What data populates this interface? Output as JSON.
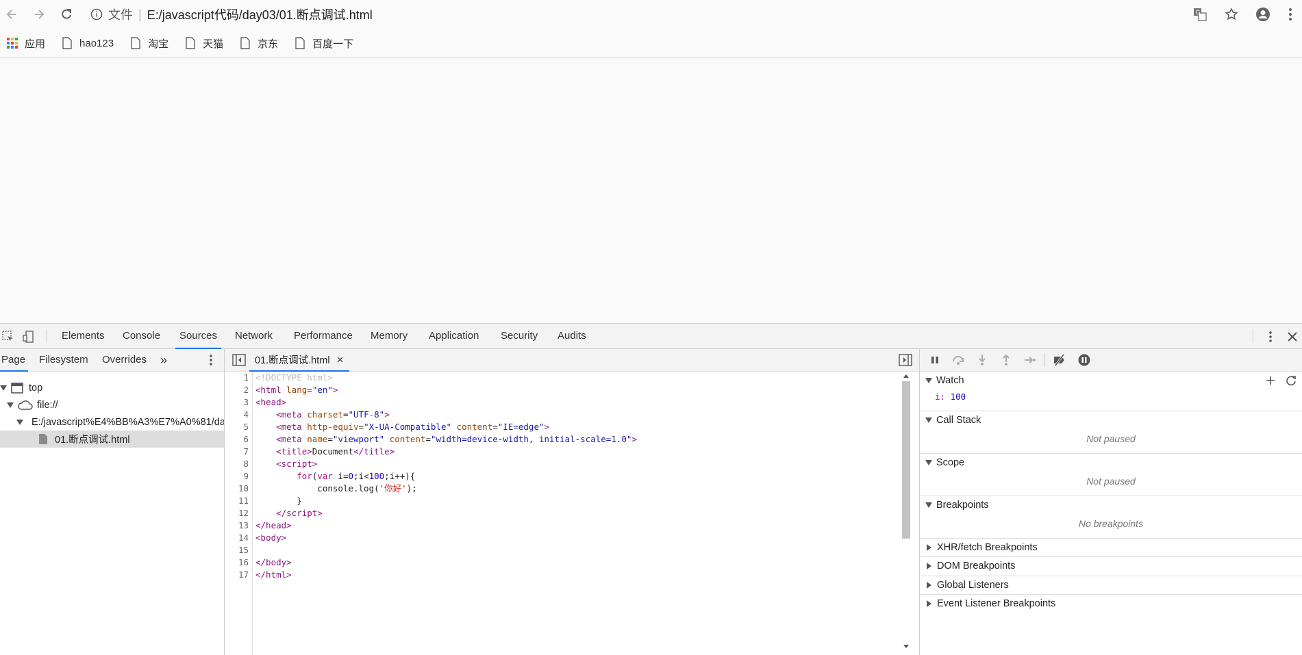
{
  "browser": {
    "scheme_label": "文件",
    "separator": "|",
    "url": "E:/javascript代码/day03/01.断点调试.html",
    "bookmarks": [
      {
        "label": "应用",
        "icon": "apps-grid-icon"
      },
      {
        "label": "hao123",
        "icon": "page-icon"
      },
      {
        "label": "淘宝",
        "icon": "page-icon"
      },
      {
        "label": "天猫",
        "icon": "page-icon"
      },
      {
        "label": "京东",
        "icon": "page-icon"
      },
      {
        "label": "百度一下",
        "icon": "page-icon"
      }
    ]
  },
  "devtools": {
    "tabs": [
      "Elements",
      "Console",
      "Sources",
      "Network",
      "Performance",
      "Memory",
      "Application",
      "Security",
      "Audits"
    ],
    "active_tab": "Sources",
    "navigator": {
      "subtabs": [
        "Page",
        "Filesystem",
        "Overrides"
      ],
      "more": "»",
      "tree": {
        "top": "top",
        "origin": "file://",
        "folder": "E:/javascript%E4%BB%A3%E7%A0%81/da",
        "file": "01.断点调试.html"
      }
    },
    "editor": {
      "open_file": "01.断点调试.html",
      "close_glyph": "×",
      "line_count": 17
    },
    "debugger": {
      "watch_label": "Watch",
      "watch_expr": "i",
      "watch_value": "100",
      "call_stack_label": "Call Stack",
      "call_stack_empty": "Not paused",
      "scope_label": "Scope",
      "scope_empty": "Not paused",
      "breakpoints_label": "Breakpoints",
      "breakpoints_empty": "No breakpoints",
      "xhr_label": "XHR/fetch Breakpoints",
      "dom_label": "DOM Breakpoints",
      "global_label": "Global Listeners",
      "event_label": "Event Listener Breakpoints"
    }
  },
  "colors": {
    "accent": "#1a73e8",
    "tag": "#881280",
    "attr": "#994500",
    "value": "#1a1aa6",
    "string": "#c41a16"
  }
}
